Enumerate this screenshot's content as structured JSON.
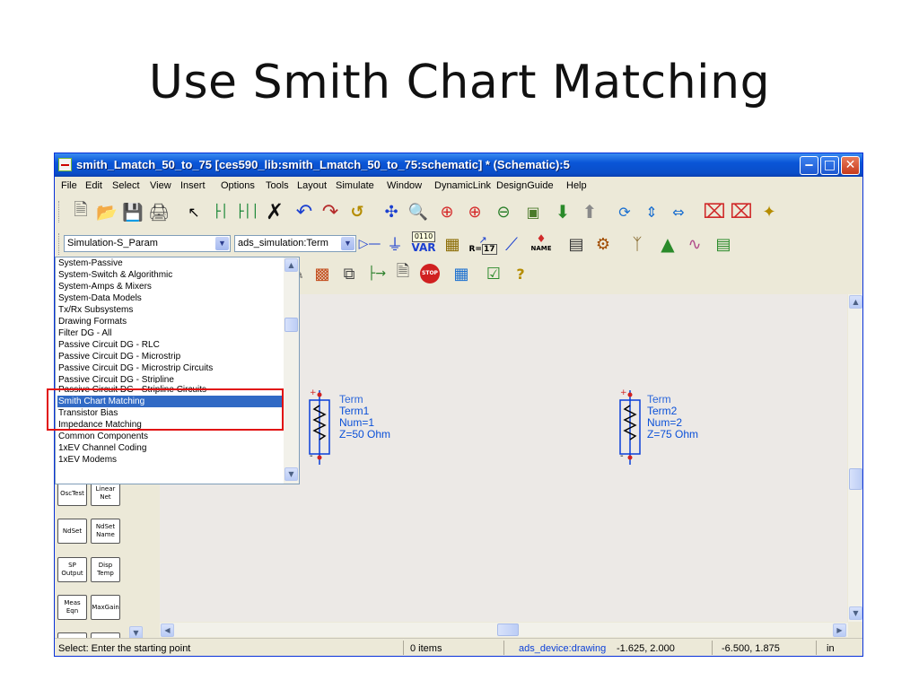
{
  "slide": {
    "title": "Use Smith Chart Matching"
  },
  "window": {
    "title": "smith_Lmatch_50_to_75 [ces590_lib:smith_Lmatch_50_to_75:schematic] * (Schematic):5",
    "controls": {
      "minimize": "‒",
      "maximize": "□",
      "close": "✕"
    }
  },
  "menu": [
    "File",
    "Edit",
    "Select",
    "View",
    "Insert",
    "Options",
    "Tools",
    "Layout",
    "Simulate",
    "Window",
    "DynamicLink",
    "DesignGuide",
    "Help"
  ],
  "toolbar2": {
    "palette_combo": "Simulation-S_Param",
    "component_combo": "ads_simulation:Term",
    "var_label": "VAR",
    "var_bits": "0110",
    "r_label": "R=",
    "r_value": "17",
    "name_label": "NAME",
    "stop_label": "STOP"
  },
  "dropdown": {
    "items": [
      "System-Passive",
      "System-Switch & Algorithmic",
      "System-Amps & Mixers",
      "System-Data Models",
      "Tx/Rx Subsystems",
      "Drawing Formats",
      "Filter DG - All",
      "Passive Circuit DG - RLC",
      "Passive Circuit DG - Microstrip",
      "Passive Circuit DG - Microstrip Circuits",
      "Passive Circuit DG - Stripline",
      "Passive Circuit DG - Stripline Circuits",
      "Smith Chart Matching",
      "Transistor Bias",
      "Impedance Matching",
      "Common Components",
      "1xEV Channel Coding",
      "1xEV Modems"
    ],
    "selected": "Smith Chart Matching",
    "partial_label": "P"
  },
  "palette": {
    "buttons": [
      {
        "a": "OscTest",
        "b": "Linear Net"
      },
      {
        "a": "NdSet",
        "b": "NdSet Name"
      },
      {
        "a": "SP Output",
        "b": "Disp Temp"
      },
      {
        "a": "Meas Eqn",
        "b": "MaxGain"
      }
    ]
  },
  "components": [
    {
      "type": "Term",
      "name": "Term1",
      "num": "Num=1",
      "z": "Z=50 Ohm"
    },
    {
      "type": "Term",
      "name": "Term2",
      "num": "Num=2",
      "z": "Z=75 Ohm"
    }
  ],
  "status": {
    "prompt": "Select: Enter the starting point",
    "items": "0 items",
    "layer": "ads_device:drawing",
    "coord1": "-1.625, 2.000",
    "coord2": "-6.500, 1.875",
    "units": "in"
  },
  "colors": {
    "accent": "#0a55d7",
    "component": "#0a50d8",
    "highlight": "#e11111",
    "selection": "#316ac5"
  }
}
